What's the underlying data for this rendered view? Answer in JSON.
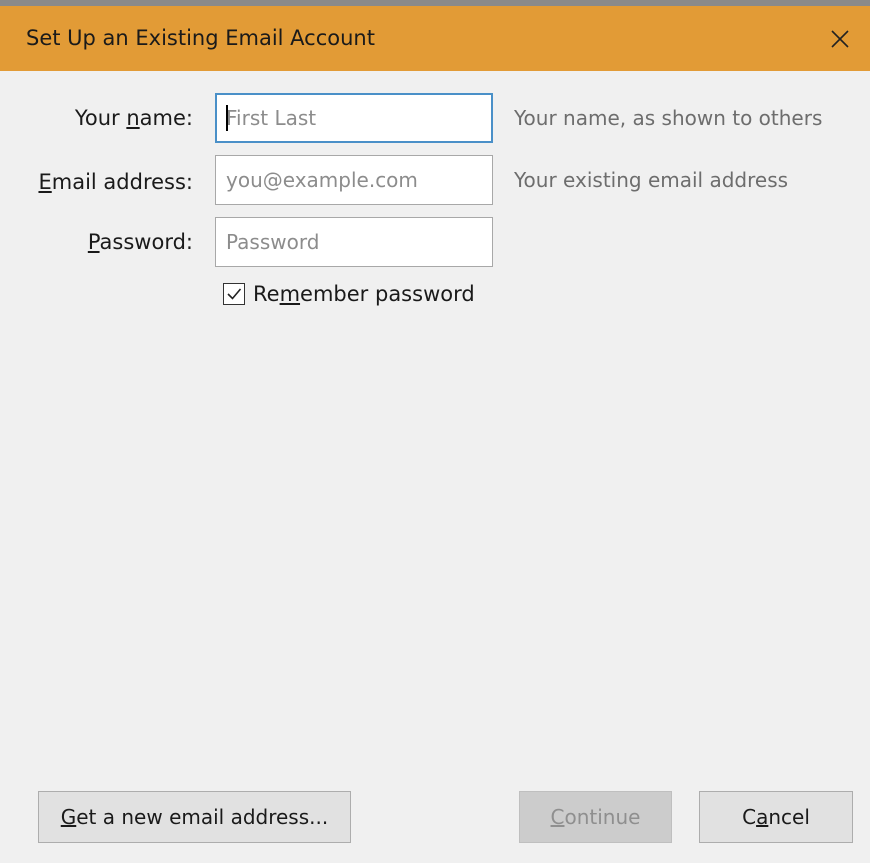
{
  "window": {
    "title": "Set Up an Existing Email Account",
    "titlebar_color": "#e29b36",
    "close_icon": "close-icon"
  },
  "form": {
    "name": {
      "label_pre": "Your ",
      "label_ul": "n",
      "label_post": "ame:",
      "value": "",
      "placeholder": "First Last",
      "hint": "Your name, as shown to others"
    },
    "email": {
      "label_pre": "",
      "label_ul": "E",
      "label_post": "mail address:",
      "value": "",
      "placeholder": "you@example.com",
      "hint": "Your existing email address"
    },
    "password": {
      "label_pre": "",
      "label_ul": "P",
      "label_post": "assword:",
      "value": "",
      "placeholder": "Password"
    },
    "remember": {
      "checked": true,
      "label_pre": "Re",
      "label_ul": "m",
      "label_post": "ember password"
    }
  },
  "buttons": {
    "new_address": {
      "pre": "",
      "ul": "G",
      "post": "et a new email address..."
    },
    "continue": {
      "pre": "",
      "ul": "C",
      "post": "ontinue",
      "disabled": true
    },
    "cancel": {
      "pre": "C",
      "ul": "a",
      "post": "ncel"
    }
  }
}
